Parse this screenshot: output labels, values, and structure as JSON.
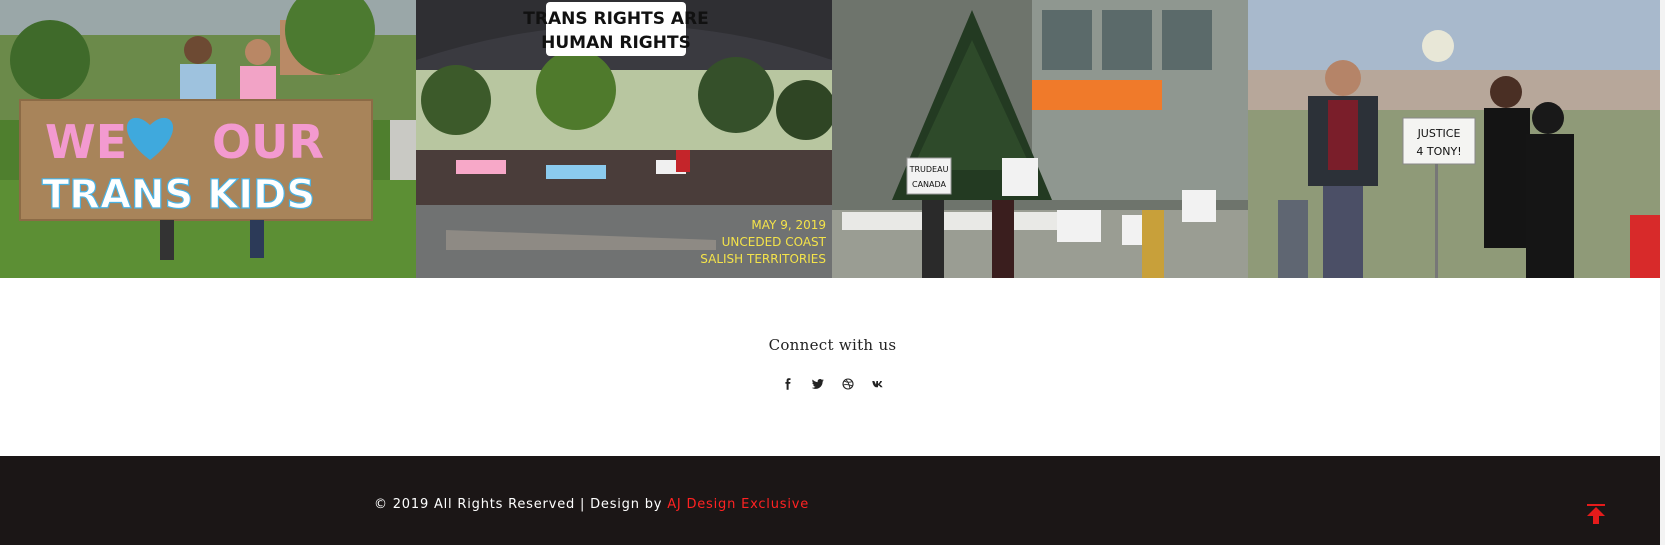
{
  "gallery": {
    "photos": [
      {
        "sign_lines": [
          "WE",
          "OUR",
          "TRANS KIDS"
        ]
      },
      {
        "banner_lines": [
          "TRANS RIGHTS ARE",
          "HUMAN RIGHTS"
        ],
        "caption_lines": [
          "MAY 9, 2019",
          "UNCEDED COAST",
          "SALISH TERRITORIES"
        ]
      },
      {
        "sign_lines": [
          "TRUDEAU",
          "CANADA"
        ]
      },
      {
        "sign_lines": [
          "JUSTICE",
          "4 TONY!"
        ]
      }
    ]
  },
  "connect": {
    "title": "Connect with us",
    "social": [
      {
        "icon": "facebook-icon"
      },
      {
        "icon": "twitter-icon"
      },
      {
        "icon": "dribbble-icon"
      },
      {
        "icon": "vk-icon"
      }
    ]
  },
  "footer": {
    "copyright_text": "© 2019 All Rights Reserved | Design by ",
    "designer_link": "AJ Design Exclusive",
    "accent_color": "#ff2222",
    "background_color": "#1b1616"
  }
}
